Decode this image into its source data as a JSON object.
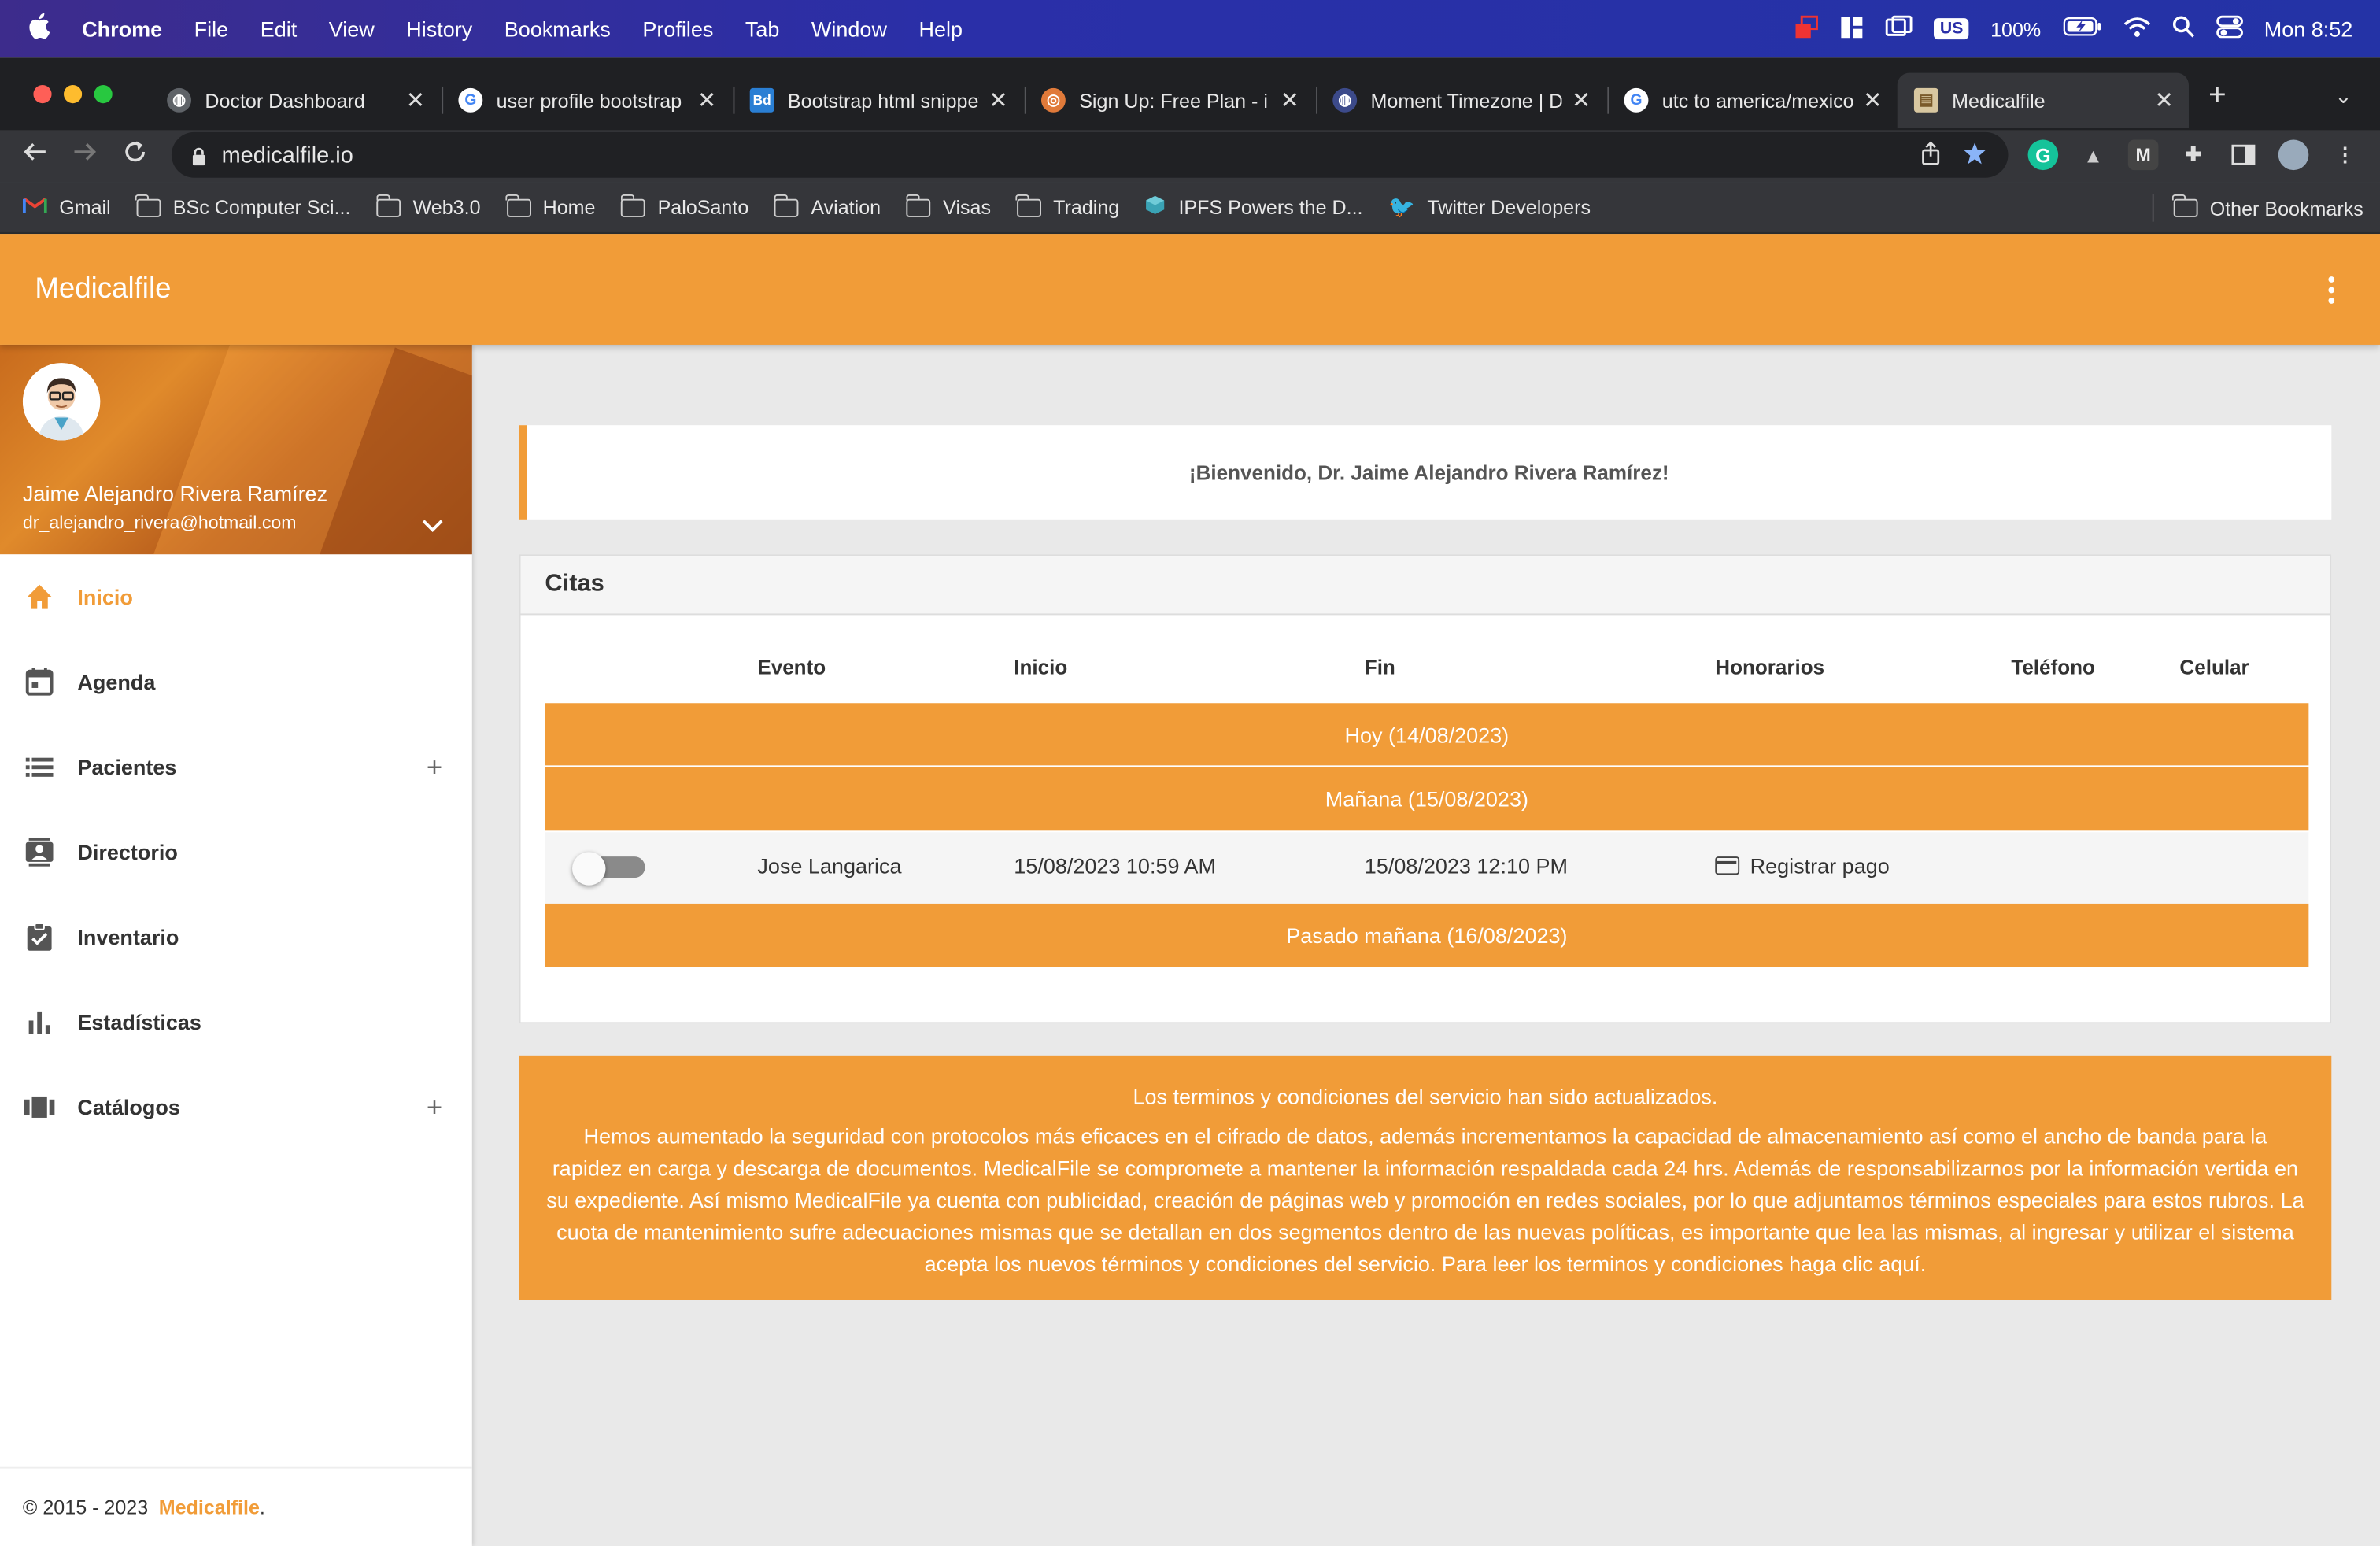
{
  "menubar": {
    "app_name": "Chrome",
    "menus": [
      "File",
      "Edit",
      "View",
      "History",
      "Bookmarks",
      "Profiles",
      "Tab",
      "Window",
      "Help"
    ],
    "input_source": "US",
    "battery": "100%",
    "clock": "Mon 8:52"
  },
  "tabs": [
    {
      "title": "Doctor Dashboard",
      "icon": "globe-icon"
    },
    {
      "title": "user profile bootstrap",
      "icon": "google-icon"
    },
    {
      "title": "Bootstrap html snippets",
      "icon": "bd-icon"
    },
    {
      "title": "Sign Up: Free Plan - i",
      "icon": "basketball-icon"
    },
    {
      "title": "Moment Timezone | D",
      "icon": "globe-icon"
    },
    {
      "title": "utc to america/mexico",
      "icon": "google-icon"
    },
    {
      "title": "Medicalfile",
      "icon": "medicalfile-icon",
      "active": true
    }
  ],
  "toolbar": {
    "url": "medicalfile.io"
  },
  "bookmarks": {
    "items": [
      "Gmail",
      "BSc Computer Sci...",
      "Web3.0",
      "Home",
      "PaloSanto",
      "Aviation",
      "Visas",
      "Trading",
      "IPFS Powers the D...",
      "Twitter Developers"
    ],
    "other": "Other Bookmarks"
  },
  "app": {
    "brand": "Medicalfile",
    "accent_color": "#f19c38"
  },
  "user": {
    "name": "Jaime Alejandro Rivera Ramírez",
    "email": "dr_alejandro_rivera@hotmail.com"
  },
  "nav": [
    {
      "label": "Inicio",
      "icon": "home-icon",
      "active": true
    },
    {
      "label": "Agenda",
      "icon": "calendar-icon"
    },
    {
      "label": "Pacientes",
      "icon": "list-icon",
      "expand": "+"
    },
    {
      "label": "Directorio",
      "icon": "contacts-icon"
    },
    {
      "label": "Inventario",
      "icon": "clipboard-check-icon"
    },
    {
      "label": "Estadísticas",
      "icon": "bar-chart-icon"
    },
    {
      "label": "Catálogos",
      "icon": "catalog-icon",
      "expand": "+"
    }
  ],
  "footer": {
    "copyright": "© 2015 - 2023",
    "brand": "Medicalfile",
    "period": "."
  },
  "welcome": "¡Bienvenido, Dr. Jaime Alejandro Rivera Ramírez!",
  "citas": {
    "title": "Citas",
    "columns": [
      "Evento",
      "Inicio",
      "Fin",
      "Honorarios",
      "Teléfono",
      "Celular"
    ],
    "groups": [
      "Hoy (14/08/2023)",
      "Mañana (15/08/2023)",
      "Pasado mañana (16/08/2023)"
    ],
    "appointment": {
      "evento": "Jose Langarica",
      "inicio": "15/08/2023 10:59 AM",
      "fin": "15/08/2023 12:10 PM",
      "honorarios": "Registrar pago",
      "toggle_on": false
    }
  },
  "notice": {
    "title": "Los terminos y condiciones del servicio han sido actualizados.",
    "body": "Hemos aumentado la seguridad con protocolos más eficaces en el cifrado de datos, además incrementamos la capacidad de almacenamiento así como el ancho de banda para la rapidez en carga y descarga de documentos. MedicalFile se compromete a mantener la información respaldada cada 24 hrs. Además de responsabilizarnos por la información vertida en su expediente. Así mismo MedicalFile ya cuenta con publicidad, creación de páginas web y promoción en redes sociales, por lo que adjuntamos términos especiales para estos rubros. La cuota de mantenimiento sufre adecuaciones mismas que se detallan en dos segmentos dentro de las nuevas políticas, es importante que lea las mismas, al ingresar y utilizar el sistema acepta los nuevos términos y condiciones del servicio. Para leer los terminos y condiciones haga clic aquí."
  }
}
